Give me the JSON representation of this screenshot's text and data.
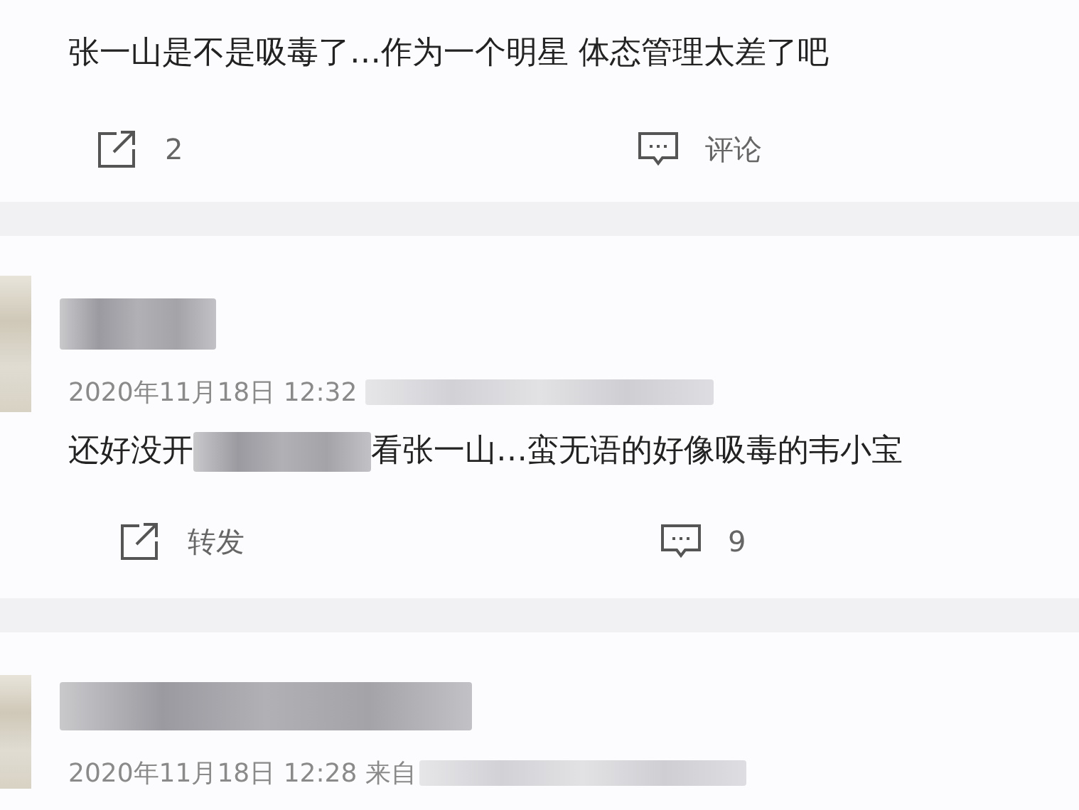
{
  "posts": [
    {
      "kind": "tail",
      "text": "张一山是不是吸毒了…作为一个明星 体态管理太差了吧",
      "actions": [
        {
          "kind": "share",
          "label": "2"
        },
        {
          "kind": "comment",
          "label": "评论"
        }
      ]
    },
    {
      "kind": "full",
      "time": "2020年11月18日 12:32",
      "text_parts": [
        "还好没开",
        "看张一山…蛮无语的好像吸毒的韦小宝"
      ],
      "actions": [
        {
          "kind": "share",
          "label": "转发"
        },
        {
          "kind": "comment",
          "label": "9"
        }
      ]
    },
    {
      "kind": "head",
      "time": "2020年11月18日 12:28",
      "source": "来自"
    }
  ]
}
